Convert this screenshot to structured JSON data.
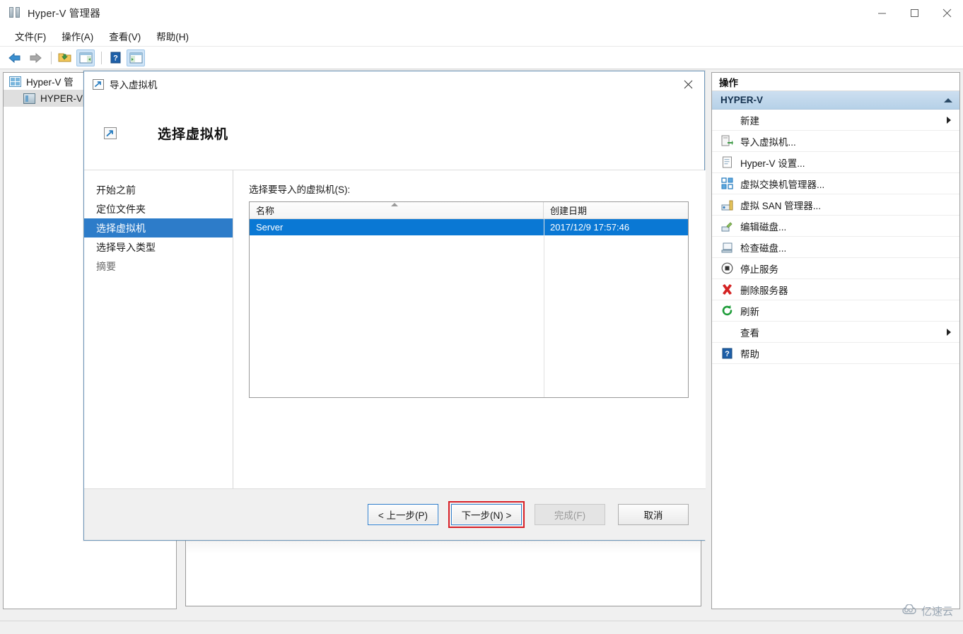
{
  "window": {
    "title": "Hyper-V 管理器",
    "icon": "server-stack-icon",
    "controls": {
      "minimize": "minimize-icon",
      "maximize": "maximize-icon",
      "close": "close-icon"
    }
  },
  "menubar": {
    "items": [
      {
        "label": "文件(F)"
      },
      {
        "label": "操作(A)"
      },
      {
        "label": "查看(V)"
      },
      {
        "label": "帮助(H)"
      }
    ]
  },
  "toolbar": {
    "buttons": [
      {
        "icon": "back-arrow-icon",
        "selected": false
      },
      {
        "icon": "forward-arrow-icon",
        "selected": false
      },
      {
        "icon": "open-folder-icon",
        "selected": false
      },
      {
        "icon": "show-pane-left-icon",
        "selected": true
      },
      {
        "icon": "help-icon",
        "selected": false
      },
      {
        "icon": "show-pane-right-icon",
        "selected": true
      }
    ]
  },
  "tree": {
    "items": [
      {
        "label": "Hyper-V 管",
        "icon": "hyperv-manager-icon",
        "selected": false
      },
      {
        "label": "HYPER-V",
        "icon": "hyperv-server-icon",
        "selected": true
      }
    ]
  },
  "actions": {
    "title": "操作",
    "group_header": "HYPER-V",
    "items": [
      {
        "label": "新建",
        "icon": "new-icon",
        "submenu": true
      },
      {
        "label": "导入虚拟机...",
        "icon": "import-vm-icon",
        "submenu": false
      },
      {
        "label": "Hyper-V 设置...",
        "icon": "settings-page-icon",
        "submenu": false
      },
      {
        "label": "虚拟交换机管理器...",
        "icon": "virtual-switch-icon",
        "submenu": false
      },
      {
        "label": "虚拟 SAN 管理器...",
        "icon": "virtual-san-icon",
        "submenu": false
      },
      {
        "label": "编辑磁盘...",
        "icon": "edit-disk-icon",
        "submenu": false
      },
      {
        "label": "检查磁盘...",
        "icon": "inspect-disk-icon",
        "submenu": false
      },
      {
        "label": "停止服务",
        "icon": "stop-service-icon",
        "submenu": false
      },
      {
        "label": "删除服务器",
        "icon": "remove-server-icon",
        "submenu": false
      },
      {
        "label": "刷新",
        "icon": "refresh-icon",
        "submenu": false
      },
      {
        "label": "查看",
        "icon": "view-icon",
        "submenu": true
      },
      {
        "label": "帮助",
        "icon": "help-icon",
        "submenu": false
      }
    ]
  },
  "dialog": {
    "titlebar_text": "导入虚拟机",
    "titlebar_icon": "import-vm-icon",
    "close_icon": "close-icon",
    "header_icon": "import-vm-icon",
    "header_title": "选择虚拟机",
    "steps": [
      {
        "label": "开始之前",
        "state": "normal"
      },
      {
        "label": "定位文件夹",
        "state": "normal"
      },
      {
        "label": "选择虚拟机",
        "state": "active"
      },
      {
        "label": "选择导入类型",
        "state": "normal"
      },
      {
        "label": "摘要",
        "state": "muted"
      }
    ],
    "panel": {
      "label": "选择要导入的虚拟机(S):",
      "columns": [
        "名称",
        "创建日期"
      ],
      "sort_column": 0,
      "sort_direction": "ascending",
      "rows": [
        {
          "name": "Server",
          "created": "2017/12/9 17:57:46",
          "selected": true
        }
      ]
    },
    "buttons": [
      {
        "label": "< 上一步(P)",
        "state": "normal",
        "highlighted": false
      },
      {
        "label": "下一步(N) >",
        "state": "focused",
        "highlighted": true
      },
      {
        "label": "完成(F)",
        "state": "disabled",
        "highlighted": false
      },
      {
        "label": "取消",
        "state": "normal",
        "highlighted": false
      }
    ]
  },
  "watermark": {
    "text": "亿速云",
    "icon": "cloud-icon"
  },
  "colors": {
    "accent_blue": "#2d7cc9",
    "selection_blue": "#0a78d4",
    "group_header_blue": "#c3d9ed",
    "highlight_red": "#d81f26",
    "window_bg": "#ffffff",
    "panel_bg": "#f0f0f0"
  }
}
